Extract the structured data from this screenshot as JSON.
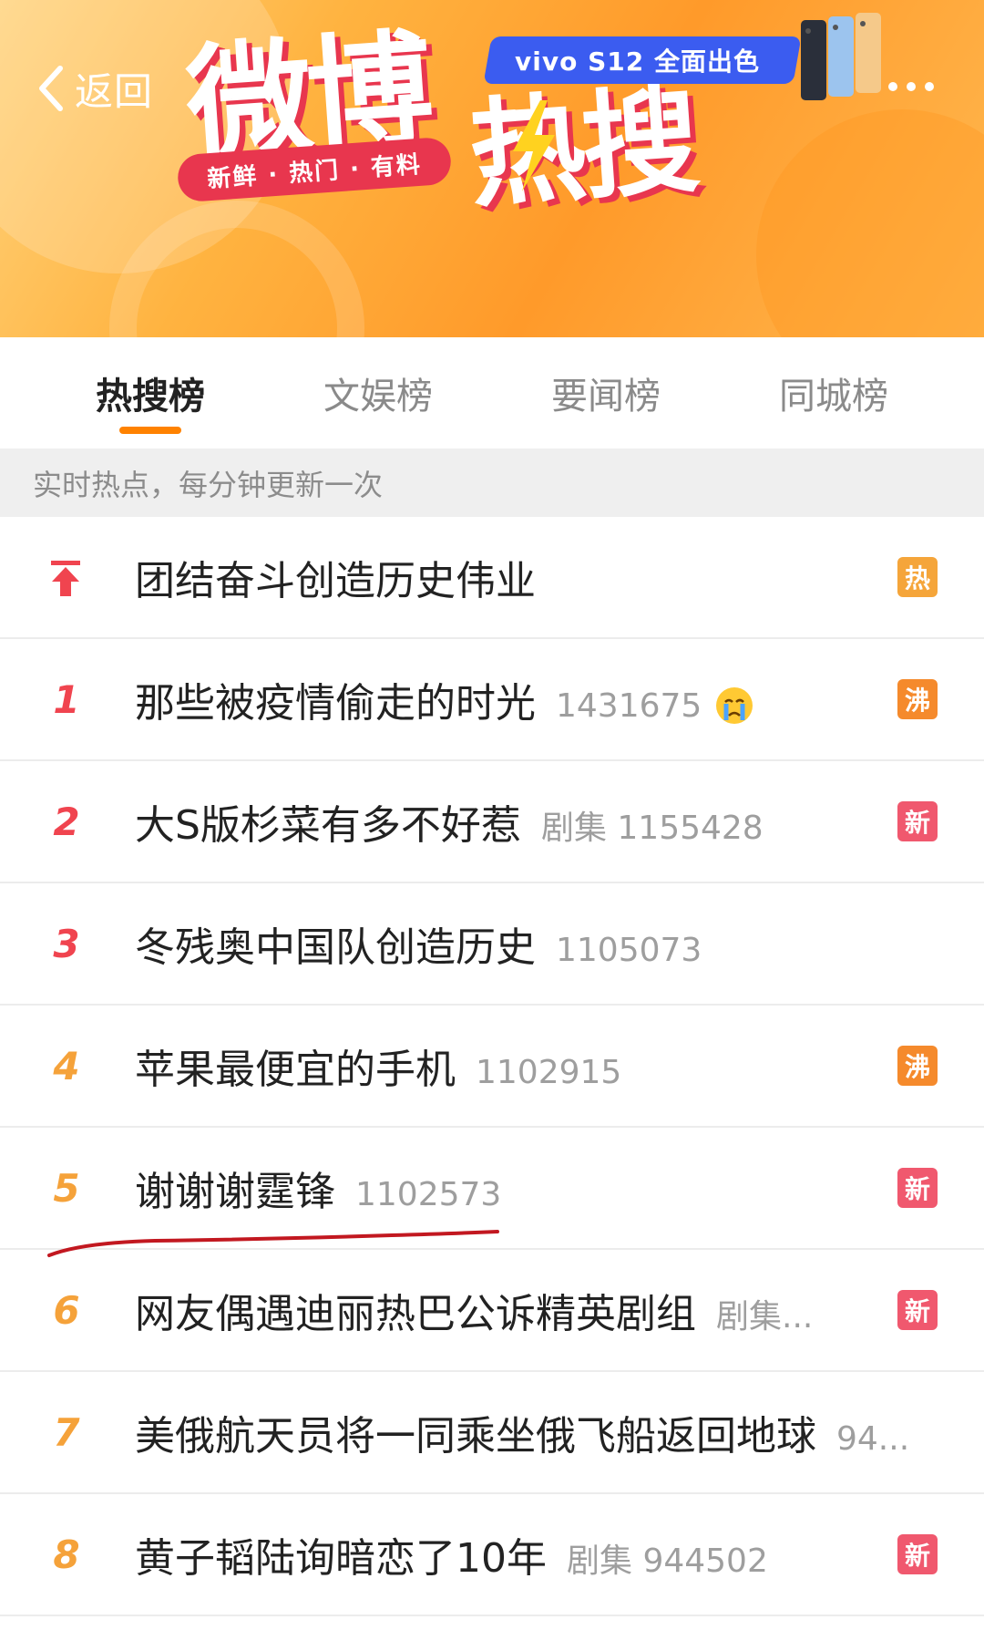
{
  "header": {
    "back_label": "返回",
    "logo_line1": "微博",
    "logo_line2": "热搜",
    "slogan": "新鲜 · 热门 · 有料",
    "ad_text": "vivo S12 全面出色"
  },
  "tabs": [
    {
      "label": "热搜榜",
      "active": true
    },
    {
      "label": "文娱榜",
      "active": false
    },
    {
      "label": "要闻榜",
      "active": false
    },
    {
      "label": "同城榜",
      "active": false
    }
  ],
  "notice": "实时热点，每分钟更新一次",
  "items": [
    {
      "rank": "",
      "pinned": true,
      "title": "团结奋斗创造历史伟业",
      "meta": "",
      "badge": "热",
      "badge_type": "hot"
    },
    {
      "rank": "1",
      "title": "那些被疫情偷走的时光",
      "meta": "1431675",
      "emoji": "crying-face-icon",
      "badge": "沸",
      "badge_type": "boil"
    },
    {
      "rank": "2",
      "title": "大S版杉菜有多不好惹",
      "meta": "剧集 1155428",
      "badge": "新",
      "badge_type": "new"
    },
    {
      "rank": "3",
      "title": "冬残奥中国队创造历史",
      "meta": "1105073",
      "badge": "",
      "badge_type": ""
    },
    {
      "rank": "4",
      "title": "苹果最便宜的手机",
      "meta": "1102915",
      "badge": "沸",
      "badge_type": "boil"
    },
    {
      "rank": "5",
      "title": "谢谢谢霆锋",
      "meta": "1102573",
      "badge": "新",
      "badge_type": "new"
    },
    {
      "rank": "6",
      "title": "网友偶遇迪丽热巴公诉精英剧组",
      "meta": "剧集...",
      "badge": "新",
      "badge_type": "new"
    },
    {
      "rank": "7",
      "title": "美俄航天员将一同乘坐俄飞船返回地球",
      "meta": "94...",
      "badge": "",
      "badge_type": ""
    },
    {
      "rank": "8",
      "title": "黄子韬陆询暗恋了10年",
      "meta": "剧集 944502",
      "badge": "新",
      "badge_type": "new"
    }
  ],
  "colors": {
    "accent": "#ff8200",
    "rank_top": "#f0444f",
    "rank_other": "#f5a23a",
    "badge_hot": "#f5a53a",
    "badge_boil": "#f58a2c",
    "badge_new": "#f0586e"
  }
}
